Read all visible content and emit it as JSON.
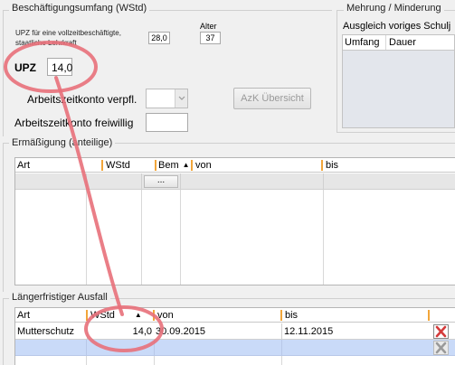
{
  "section_employment": {
    "title": "Beschäftigungsumfang (WStd)",
    "upz_full_label_line1": "UPZ für eine vollzeitbeschäftigte,",
    "upz_full_label_line2": "staatliche Lehrkraft",
    "upz_full_value": "28,0",
    "alter_label": "Alter",
    "alter_value": "37",
    "upz_label": "UPZ",
    "upz_value": "14,0",
    "azk_verpfl_label": "Arbeitszeitkonto verpfl.",
    "azk_verpfl_value": "",
    "azk_button_label": "AzK Übersicht",
    "azk_freiwillig_label": "Arbeitszeitkonto freiwillig",
    "azk_freiwillig_value": ""
  },
  "section_mehrung": {
    "title": "Mehrung / Minderung",
    "subtitle": "Ausgleich voriges Schulj",
    "columns": [
      "Umfang",
      "Dauer"
    ]
  },
  "section_ermaessigung": {
    "title": "Ermäßigung (anteilige)",
    "columns": [
      "Art",
      "WStd",
      "Bem",
      "von",
      "bis"
    ],
    "ellipsis_label": "..."
  },
  "section_ausfall": {
    "title": "Längerfristiger Ausfall",
    "columns": [
      "Art",
      "WStd",
      "von",
      "bis"
    ],
    "rows": [
      {
        "art": "Mutterschutz",
        "wstd": "14,0",
        "von": "30.09.2015",
        "bis": "12.11.2015"
      }
    ]
  },
  "colors": {
    "annotation": "#e8707a",
    "header_separator": "#f2a63a",
    "selected_row": "#c9daf8",
    "delete_red": "#d43b3b"
  }
}
